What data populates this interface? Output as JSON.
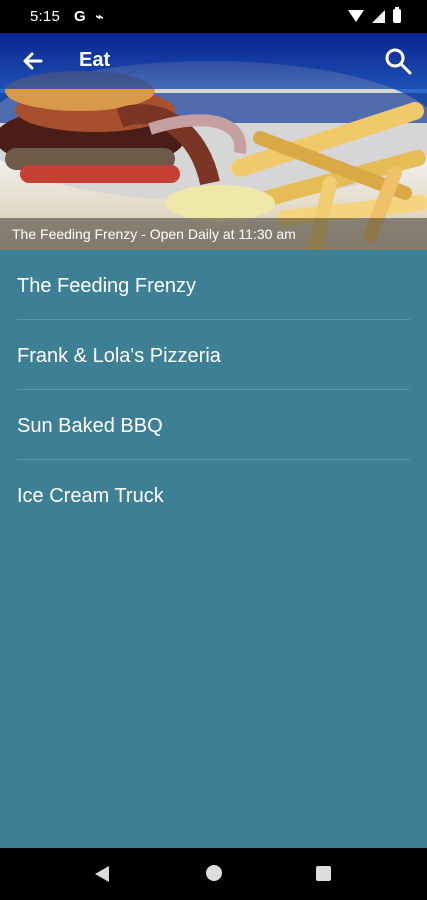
{
  "status": {
    "time": "5:15",
    "icons": [
      "g-icon",
      "s-icon",
      "wifi-icon",
      "signal-icon",
      "battery-icon"
    ]
  },
  "toolbar": {
    "title": "Eat",
    "back_icon": "back-arrow-icon",
    "search_icon": "search-icon",
    "background": "#1b48b5"
  },
  "hero": {
    "caption": "The Feeding Frenzy - Open Daily at 11:30 am"
  },
  "list": {
    "items": [
      {
        "label": "The Feeding Frenzy"
      },
      {
        "label": "Frank & Lola's Pizzeria"
      },
      {
        "label": "Sun Baked BBQ"
      },
      {
        "label": "Ice Cream Truck"
      }
    ]
  },
  "colors": {
    "background": "#3d7f95",
    "text": "#ffffff",
    "status_bar": "#000000",
    "nav_bar": "#000000"
  },
  "nav": {
    "icons": [
      "back-icon",
      "home-icon",
      "recents-icon"
    ]
  }
}
